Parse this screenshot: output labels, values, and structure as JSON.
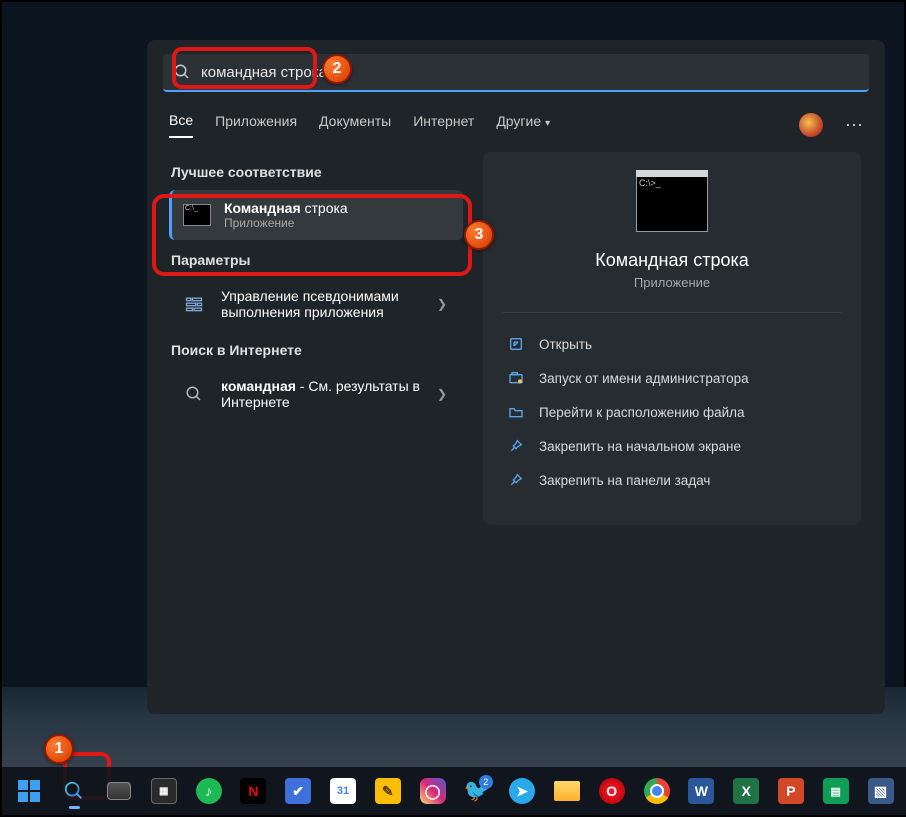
{
  "search": {
    "query": "командная строка"
  },
  "tabs": {
    "all": "Все",
    "apps": "Приложения",
    "docs": "Документы",
    "internet": "Интернет",
    "more": "Другие"
  },
  "sections": {
    "best": "Лучшее соответствие",
    "settings": "Параметры",
    "web": "Поиск в Интернете"
  },
  "results": {
    "cmd": {
      "title_bold": "Командная",
      "title_rest": " строка",
      "subtitle": "Приложение"
    },
    "alias": {
      "title": "Управление псевдонимами выполнения приложения"
    },
    "web": {
      "title_bold": "командная",
      "title_rest": " - См. результаты в Интернете"
    }
  },
  "detail": {
    "title": "Командная строка",
    "subtitle": "Приложение",
    "actions": {
      "open": "Открыть",
      "admin": "Запуск от имени администратора",
      "location": "Перейти к расположению файла",
      "pin_start": "Закрепить на начальном экране",
      "pin_taskbar": "Закрепить на панели задач"
    }
  },
  "steps": {
    "s1": "1",
    "s2": "2",
    "s3": "3"
  },
  "taskbar": {
    "twitter_badge": "2"
  }
}
